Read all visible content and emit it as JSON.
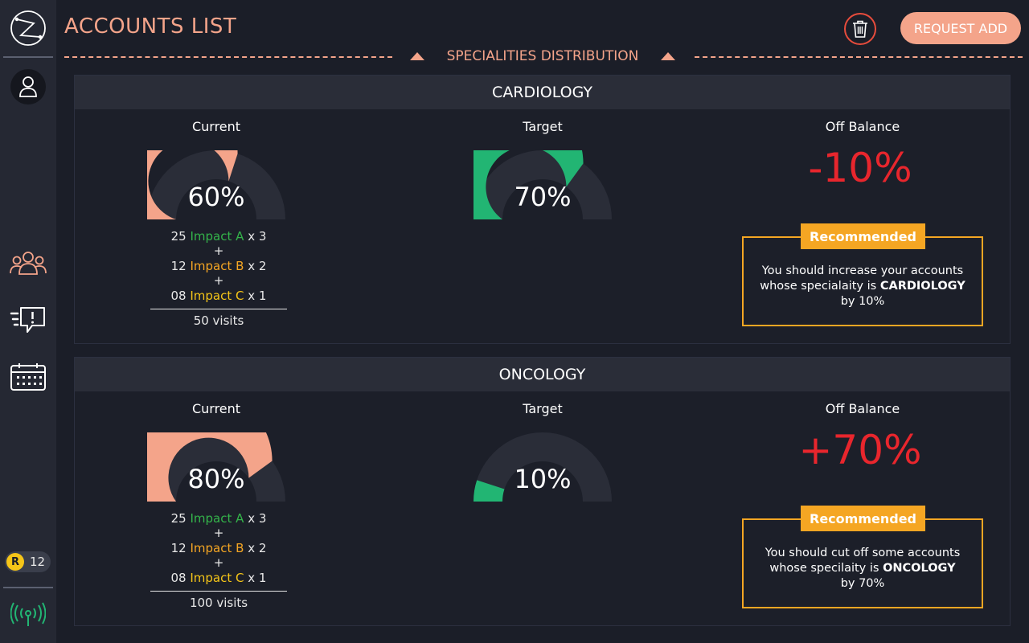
{
  "header": {
    "title": "ACCOUNTS LIST",
    "request_label": "REQUEST ADD"
  },
  "section": {
    "label": "SPECIALITIES DISTRIBUTION"
  },
  "sidebar": {
    "badge_letter": "R",
    "badge_count": "12"
  },
  "colors": {
    "accent": "#f4a48a",
    "good": "#22b573",
    "alert": "#e8262d",
    "warning": "#f5a623"
  },
  "icons": [
    "logo-icon",
    "user-icon",
    "team-icon",
    "alert-chat-icon",
    "calendar-icon",
    "coin-icon",
    "signal-icon",
    "trash-icon",
    "triangle-up-icon"
  ],
  "cards": [
    {
      "name": "CARDIOLOGY",
      "current_label": "Current",
      "current_value": "60%",
      "current_fraction": 0.6,
      "target_label": "Target",
      "target_value": "70%",
      "target_fraction": 0.7,
      "off_label": "Off Balance",
      "off_value": "-10%",
      "calc": {
        "a_num": "25",
        "a_label": "Impact A",
        "a_mult": "x 3",
        "plus": "+",
        "b_num": "12",
        "b_label": "Impact B",
        "b_mult": "x 2",
        "c_num": "08",
        "c_label": "Impact C",
        "c_mult": "x 1",
        "total": "50 visits"
      },
      "rec": {
        "label": "Recommended",
        "line1": "You should increase your accounts",
        "line2a": "whose specialaity is ",
        "line2b": "CARDIOLOGY",
        "line3": "by 10%"
      }
    },
    {
      "name": "ONCOLOGY",
      "current_label": "Current",
      "current_value": "80%",
      "current_fraction": 0.8,
      "target_label": "Target",
      "target_value": "10%",
      "target_fraction": 0.1,
      "off_label": "Off Balance",
      "off_value": "+70%",
      "calc": {
        "a_num": "25",
        "a_label": "Impact A",
        "a_mult": "x 3",
        "plus": "+",
        "b_num": "12",
        "b_label": "Impact B",
        "b_mult": "x 2",
        "c_num": "08",
        "c_label": "Impact C",
        "c_mult": "x 1",
        "total": "100 visits"
      },
      "rec": {
        "label": "Recommended",
        "line1": "You should cut off some accounts",
        "line2a": "whose specilaity is ",
        "line2b": "ONCOLOGY",
        "line3": "by 70%"
      }
    }
  ]
}
